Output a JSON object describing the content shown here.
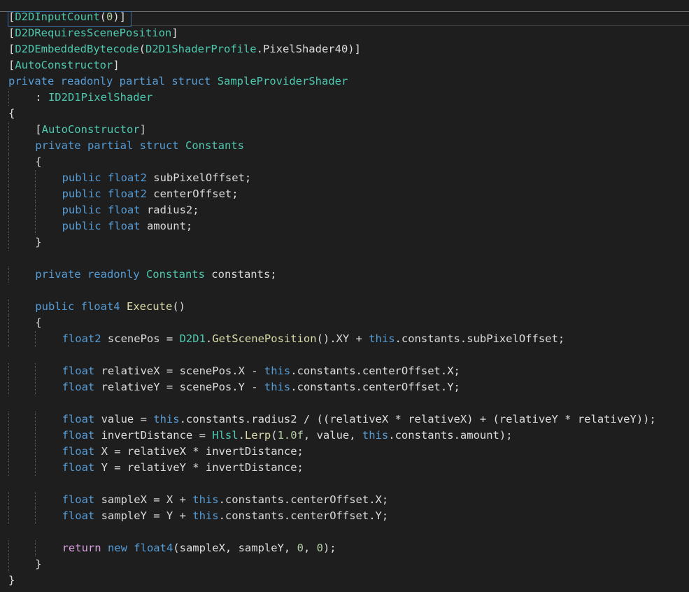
{
  "editor": {
    "language": "C#",
    "theme": "dark",
    "lines": [
      "[D2DInputCount(0)]",
      "[D2DRequiresScenePosition]",
      "[D2DEmbeddedBytecode(D2D1ShaderProfile.PixelShader40)]",
      "[AutoConstructor]",
      "private readonly partial struct SampleProviderShader",
      "    : ID2D1PixelShader",
      "{",
      "    [AutoConstructor]",
      "    private partial struct Constants",
      "    {",
      "        public float2 subPixelOffset;",
      "        public float2 centerOffset;",
      "        public float radius2;",
      "        public float amount;",
      "    }",
      "",
      "    private readonly Constants constants;",
      "",
      "    public float4 Execute()",
      "    {",
      "        float2 scenePos = D2D1.GetScenePosition().XY + this.constants.subPixelOffset;",
      "",
      "        float relativeX = scenePos.X - this.constants.centerOffset.X;",
      "        float relativeY = scenePos.Y - this.constants.centerOffset.Y;",
      "",
      "        float value = this.constants.radius2 / ((relativeX * relativeX) + (relativeY * relativeY));",
      "        float invertDistance = Hlsl.Lerp(1.0f, value, this.constants.amount);",
      "        float X = relativeX * invertDistance;",
      "        float Y = relativeY * invertDistance;",
      "",
      "        float sampleX = X + this.constants.centerOffset.X;",
      "        float sampleY = Y + this.constants.centerOffset.Y;",
      "",
      "        return new float4(sampleX, sampleY, 0, 0);",
      "    }",
      "}"
    ]
  },
  "colors": {
    "background": "#1e1e1e",
    "keyword": "#569cd6",
    "type": "#4ec9b0",
    "method": "#dcdcaa",
    "control": "#d8a0df",
    "number": "#b5cea8",
    "text": "#dcdcdc"
  }
}
